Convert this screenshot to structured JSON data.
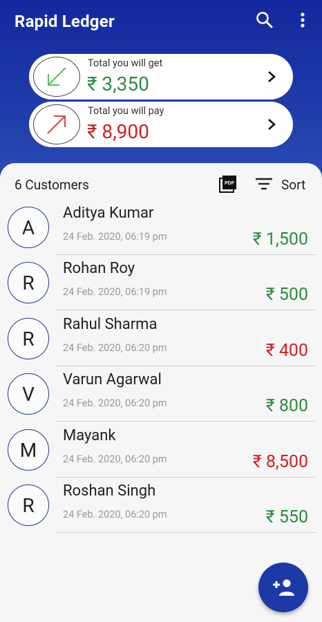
{
  "app": {
    "title": "Rapid Ledger"
  },
  "toolbar": {
    "search_icon": "search-icon",
    "more_icon": "more-vert-icon"
  },
  "summary": {
    "get": {
      "label": "Total you will get",
      "amount": "₹ 3,350",
      "color": "#2b8c3f",
      "icon": "arrow-down-left-icon"
    },
    "pay": {
      "label": "Total you will pay",
      "amount": "₹ 8,900",
      "color": "#d02020",
      "icon": "arrow-up-right-icon"
    }
  },
  "list_header": {
    "count_label": "6 Customers",
    "pdf_icon": "pdf-icon",
    "sort_label": "Sort"
  },
  "customers": [
    {
      "initial": "A",
      "name": "Aditya Kumar",
      "date": "24 Feb. 2020, 06:19 pm",
      "amount": "₹ 1,500",
      "type": "get"
    },
    {
      "initial": "R",
      "name": "Rohan Roy",
      "date": "24 Feb. 2020, 06:19 pm",
      "amount": "₹ 500",
      "type": "get"
    },
    {
      "initial": "R",
      "name": "Rahul Sharma",
      "date": "24 Feb. 2020, 06:20 pm",
      "amount": "₹ 400",
      "type": "pay"
    },
    {
      "initial": "V",
      "name": "Varun Agarwal",
      "date": "24 Feb. 2020, 06:20 pm",
      "amount": "₹ 800",
      "type": "get"
    },
    {
      "initial": "M",
      "name": "Mayank",
      "date": "24 Feb. 2020, 06:20 pm",
      "amount": "₹ 8,500",
      "type": "pay"
    },
    {
      "initial": "R",
      "name": "Roshan Singh",
      "date": "24 Feb. 2020, 06:20 pm",
      "amount": "₹ 550",
      "type": "get"
    }
  ],
  "fab": {
    "icon": "add-person-icon"
  },
  "colors": {
    "primary": "#1c39a6",
    "get": "#2b8c3f",
    "pay": "#d02020"
  }
}
